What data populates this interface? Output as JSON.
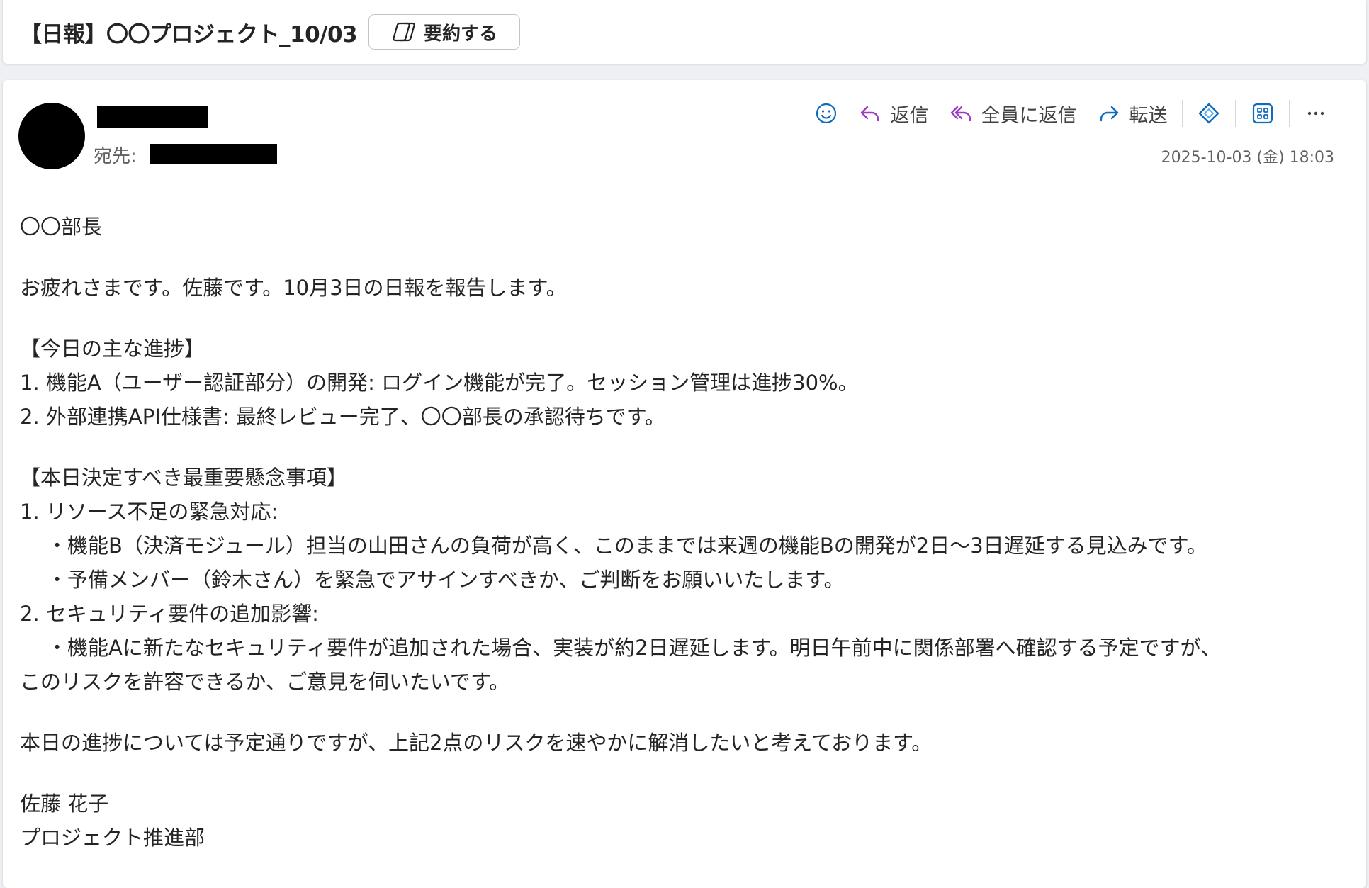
{
  "subject": {
    "title": "【日報】〇〇プロジェクト_10/03",
    "summarize_label": "要約する"
  },
  "header": {
    "to_label": "宛先:",
    "timestamp": "2025-10-03 (金) 18:03",
    "actions": {
      "reply": "返信",
      "reply_all": "全員に返信",
      "forward": "転送"
    }
  },
  "body": {
    "greeting": "〇〇部長",
    "intro": "お疲れさまです。佐藤です。10月3日の日報を報告します。",
    "progress_heading": "【今日の主な進捗】",
    "progress_1": "1. 機能A（ユーザー認証部分）の開発: ログイン機能が完了。セッション管理は進捗30%。",
    "progress_2": "2. 外部連携API仕様書: 最終レビュー完了、〇〇部長の承認待ちです。",
    "concern_heading": "【本日決定すべき最重要懸念事項】",
    "concern_1": "1. リソース不足の緊急対応:",
    "concern_1_a": "・機能B（決済モジュール）担当の山田さんの負荷が高く、このままでは来週の機能Bの開発が2日〜3日遅延する見込みです。",
    "concern_1_b": "・予備メンバー（鈴木さん）を緊急でアサインすべきか、ご判断をお願いいたします。",
    "concern_2": "2. セキュリティ要件の追加影響:",
    "concern_2_a": "・機能Aに新たなセキュリティ要件が追加された場合、実装が約2日遅延します。明日午前中に関係部署へ確認する予定ですが、",
    "concern_2_b": "このリスクを許容できるか、ご意見を伺いたいです。",
    "closing": "本日の進捗については予定通りですが、上記2点のリスクを速やかに解消したいと考えております。",
    "signature_name": "佐藤 花子",
    "signature_dept": "プロジェクト推進部"
  },
  "colors": {
    "icon_blue": "#0f6cbd",
    "icon_purple": "#9a3fbf",
    "text": "#242424",
    "muted": "#616161"
  }
}
